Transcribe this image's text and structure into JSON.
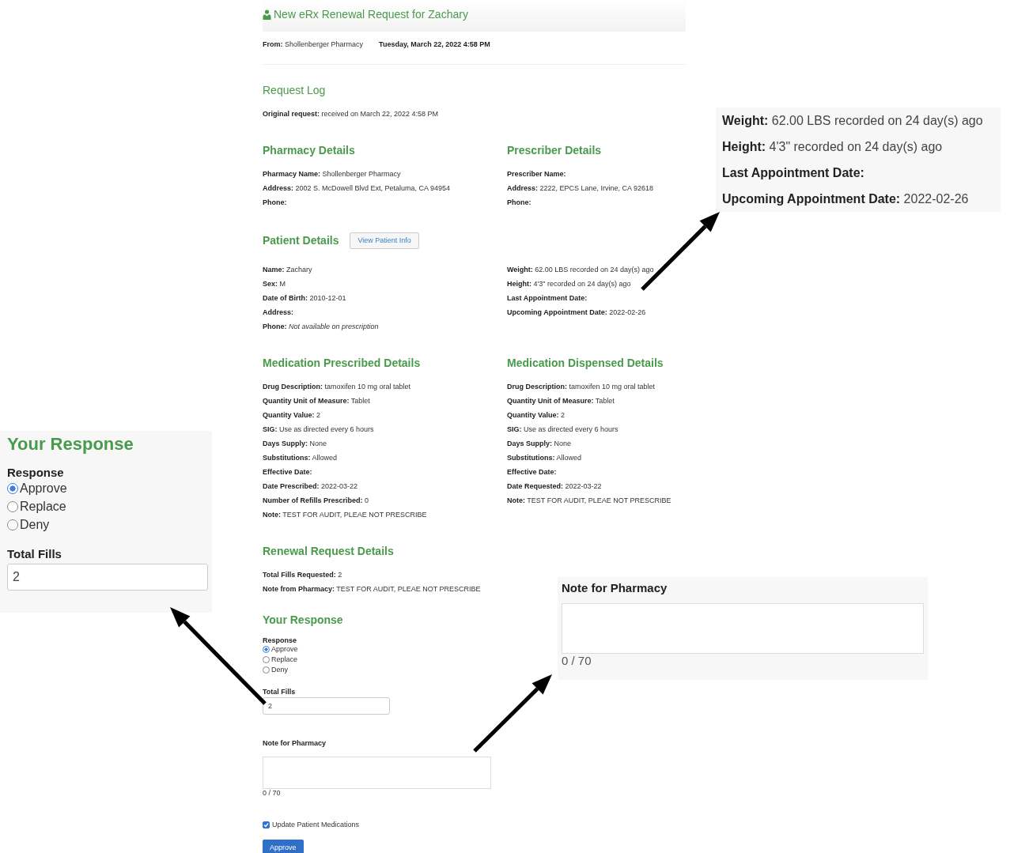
{
  "header": {
    "title": "New eRx Renewal Request for Zachary",
    "from": "**From:** Shollenberger Pharmacy",
    "date": "Tuesday, March 22, 2022 4:58 PM"
  },
  "request_log": {
    "heading": "Request Log",
    "fields": [
      "**Original request:** received on March 22, 2022 4:58 PM"
    ]
  },
  "section_rows": [
    {
      "sections": [
        {
          "heading": "Pharmacy Details",
          "fields": [
            "**Pharmacy Name:** Shollenberger Pharmacy",
            "**Address:** 2002 S. McDowell Blvd Ext, Petaluma, CA 94954",
            "**Phone:**"
          ]
        },
        {
          "heading": "Prescriber Details",
          "fields": [
            "**Prescriber Name:**",
            "**Address:** 2222, EPCS Lane, Irvine, CA 92618",
            "**Phone:**"
          ]
        }
      ]
    },
    {
      "sections": [
        {
          "heading": "Patient Details",
          "button": "View Patient Info",
          "fields": [
            "**Name:** Zachary",
            "**Sex:** M",
            "**Date of Birth:** 2010-12-01",
            "**Address:**",
            "**Phone:** *Not available on prescription*"
          ]
        },
        {
          "fields": [
            "**Weight:** 62.00 LBS recorded on 24 day(s) ago",
            "**Height:** 4'3\" recorded on 24 day(s) ago",
            "**Last Appointment Date:**",
            "**Upcoming Appointment Date:** 2022-02-26"
          ]
        }
      ]
    },
    {
      "sections": [
        {
          "heading": "Medication Prescribed Details",
          "fields": [
            "**Drug Description:** tamoxifen 10 mg oral tablet",
            "**Quantity Unit of Measure:** Tablet",
            "**Quantity Value:** 2",
            "**SIG:** Use as directed every 6 hours",
            "**Days Supply:** None",
            "**Substitutions:** Allowed",
            "**Effective Date:**",
            "**Date Prescribed:** 2022-03-22",
            "**Number of Refills Prescribed:** 0",
            "**Note:** TEST FOR AUDIT, PLEAE NOT PRESCRIBE"
          ]
        },
        {
          "heading": "Medication Dispensed Details",
          "fields": [
            "**Drug Description:** tamoxifen 10 mg oral tablet",
            "**Quantity Unit of Measure:** Tablet",
            "**Quantity Value:** 2",
            "**SIG:** Use as directed every 6 hours",
            "**Days Supply:** None",
            "**Substitutions:** Allowed",
            "**Effective Date:**",
            "**Date Requested:** 2022-03-22",
            "**Note:** TEST FOR AUDIT, PLEAE NOT PRESCRIBE"
          ]
        }
      ]
    },
    {
      "sections": [
        {
          "heading": "Renewal Request Details",
          "fields": [
            "**Total Fills Requested:** 2",
            "**Note from Pharmacy:** TEST FOR AUDIT, PLEAE NOT PRESCRIBE"
          ]
        }
      ]
    }
  ],
  "response": {
    "heading": "Your Response",
    "response_label": "Response",
    "options": [
      {
        "label": "Approve",
        "selected": true
      },
      {
        "label": "Replace",
        "selected": false
      },
      {
        "label": "Deny",
        "selected": false
      }
    ],
    "fills_label": "Total Fills",
    "fills_value": "2",
    "note_label": "Note for Pharmacy",
    "counter": "0 / 70",
    "update": {
      "label": "Update Patient Medications",
      "checked": true
    },
    "submit": "Approve"
  },
  "callouts": [
    {
      "kind": "fields",
      "fields": [
        "**Weight:** 62.00 LBS recorded on 24 day(s) ago",
        "**Height:** 4'3\" recorded on 24 day(s) ago",
        "**Last Appointment Date:**",
        "**Upcoming Appointment Date:** 2022-02-26"
      ]
    },
    {
      "kind": "response",
      "heading": "Your Response",
      "response_label": "Response",
      "options": [
        {
          "label": "Approve",
          "selected": true
        },
        {
          "label": "Replace",
          "selected": false
        },
        {
          "label": "Deny",
          "selected": false
        }
      ],
      "fills_label": "Total Fills",
      "fills_value": "2"
    },
    {
      "kind": "note",
      "label": "Note for Pharmacy",
      "counter": "0 / 70"
    }
  ]
}
